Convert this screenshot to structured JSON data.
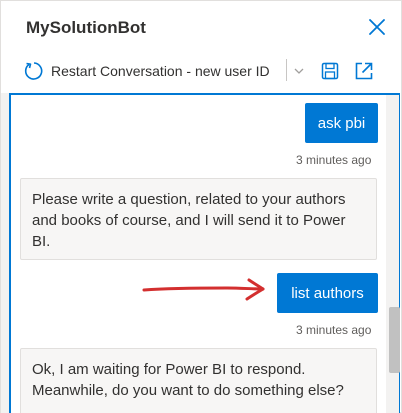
{
  "app": {
    "title": "MySolutionBot"
  },
  "toolbar": {
    "restart_label": "Restart Conversation - new user ID",
    "icons": [
      "restart-icon",
      "chevron-down-icon",
      "save-icon",
      "popout-icon"
    ]
  },
  "chat": {
    "messages": [
      {
        "from": "user",
        "text": "ask pbi",
        "time": "3 minutes ago"
      },
      {
        "from": "bot",
        "text": "Please write a question, related to your authors and books of course, and I will send it to Power BI."
      },
      {
        "from": "user",
        "text": "list authors",
        "time": "3 minutes ago"
      },
      {
        "from": "bot",
        "text": "Ok, I am waiting for Power BI to respond. Meanwhile, do you want to do something else?"
      }
    ]
  },
  "colors": {
    "accent": "#0078d4",
    "annotation_arrow": "#d32f2f",
    "bot_bubble_bg": "#f7f6f5"
  }
}
